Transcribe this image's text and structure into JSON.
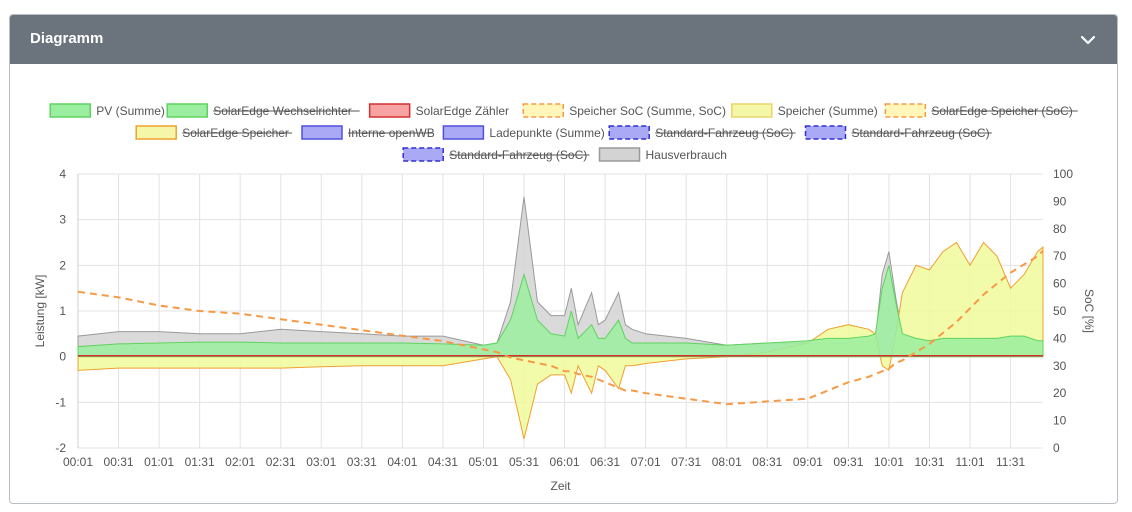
{
  "card": {
    "title": "Diagramm",
    "collapse_icon": "chevron-down-icon"
  },
  "colors": {
    "header_bg": "#6b747d",
    "pv": "#5fd35f",
    "pv_fill": "#9beea0",
    "house": "#9a9a9a",
    "house_fill": "#d3d3d3",
    "storage": "#f0a030",
    "storage_fill": "#eefa9a",
    "soc": "#f79a46",
    "meter": "#d43030"
  },
  "chart_data": {
    "type": "area",
    "xlabel": "Zeit",
    "ylabel": "Leistung [kW]",
    "y2label": "SoC [%]",
    "ylim": [
      -2,
      4
    ],
    "y2lim": [
      0,
      100
    ],
    "yticks": [
      "4",
      "3",
      "2",
      "1",
      "0",
      "-1",
      "-2"
    ],
    "y2ticks": [
      "100",
      "90",
      "80",
      "70",
      "60",
      "50",
      "40",
      "30",
      "20",
      "10",
      "0"
    ],
    "x_ticks": [
      "00:01",
      "00:31",
      "01:01",
      "01:31",
      "02:01",
      "02:31",
      "03:01",
      "03:31",
      "04:01",
      "04:31",
      "05:01",
      "05:31",
      "06:01",
      "06:31",
      "07:01",
      "07:31",
      "08:01",
      "08:31",
      "09:01",
      "09:31",
      "10:01",
      "10:31",
      "11:01",
      "11:31"
    ],
    "grid": true,
    "legend_position": "top",
    "legend": [
      {
        "label": "PV (Summe)",
        "style": "solid",
        "color": "#5fd35f",
        "fill": "#9beea0",
        "hidden": false
      },
      {
        "label": "SolarEdge Wechselrichter",
        "style": "solid",
        "color": "#5fd35f",
        "fill": "#9beea0",
        "hidden": true
      },
      {
        "label": "SolarEdge Zähler",
        "style": "solid",
        "color": "#d43030",
        "fill": "#f7a3a3",
        "hidden": false
      },
      {
        "label": "Speicher SoC (Summe, SoC)",
        "style": "dashed",
        "color": "#f79a46",
        "fill": "#fff6b8",
        "hidden": false
      },
      {
        "label": "Speicher (Summe)",
        "style": "solid",
        "color": "#e8d56a",
        "fill": "#f5f7a8",
        "hidden": false
      },
      {
        "label": "SolarEdge Speicher (SoC)",
        "style": "dashed",
        "color": "#f79a46",
        "fill": "#fff6b8",
        "hidden": true
      },
      {
        "label": "SolarEdge Speicher",
        "style": "solid",
        "color": "#f0a030",
        "fill": "#f5f7a8",
        "hidden": true
      },
      {
        "label": "Interne openWB",
        "style": "solid",
        "color": "#5050e0",
        "fill": "#a9a9f5",
        "hidden": true
      },
      {
        "label": "Ladepunkte (Summe)",
        "style": "solid",
        "color": "#5050e0",
        "fill": "#a9a9f5",
        "hidden": false
      },
      {
        "label": "Standard-Fahrzeug (SoC)",
        "style": "dashed",
        "color": "#3030d0",
        "fill": "#a9a9f5",
        "hidden": true
      },
      {
        "label": "Standard-Fahrzeug (SoC)",
        "style": "dashed",
        "color": "#3030d0",
        "fill": "#a9a9f5",
        "hidden": true
      },
      {
        "label": "Standard-Fahrzeug (SoC)",
        "style": "dashed",
        "color": "#3030d0",
        "fill": "#a9a9f5",
        "hidden": true
      },
      {
        "label": "Hausverbrauch",
        "style": "solid",
        "color": "#9a9a9a",
        "fill": "#d3d3d3",
        "hidden": false
      }
    ],
    "x": [
      "00:01",
      "00:31",
      "01:01",
      "01:31",
      "02:01",
      "02:31",
      "03:01",
      "03:31",
      "04:01",
      "04:31",
      "05:01",
      "05:11",
      "05:21",
      "05:31",
      "05:41",
      "05:51",
      "06:01",
      "06:06",
      "06:11",
      "06:21",
      "06:26",
      "06:31",
      "06:41",
      "06:46",
      "06:51",
      "07:01",
      "07:31",
      "08:01",
      "08:31",
      "09:01",
      "09:16",
      "09:31",
      "09:46",
      "09:51",
      "09:56",
      "10:01",
      "10:06",
      "10:11",
      "10:21",
      "10:31",
      "10:41",
      "10:51",
      "11:01",
      "11:11",
      "11:21",
      "11:31",
      "11:41",
      "11:51",
      "11:55"
    ],
    "series": [
      {
        "name": "PV (Summe)",
        "values": [
          0.22,
          0.28,
          0.3,
          0.32,
          0.32,
          0.3,
          0.3,
          0.3,
          0.3,
          0.28,
          0.25,
          0.3,
          0.8,
          1.8,
          0.8,
          0.5,
          0.45,
          1.0,
          0.4,
          0.7,
          0.4,
          0.4,
          0.8,
          0.4,
          0.3,
          0.3,
          0.3,
          0.25,
          0.3,
          0.35,
          0.4,
          0.4,
          0.45,
          0.5,
          1.5,
          2.0,
          1.2,
          0.5,
          0.4,
          0.35,
          0.4,
          0.4,
          0.4,
          0.4,
          0.4,
          0.45,
          0.45,
          0.35,
          0.35
        ]
      },
      {
        "name": "Hausverbrauch",
        "values": [
          0.45,
          0.55,
          0.55,
          0.5,
          0.5,
          0.6,
          0.55,
          0.5,
          0.45,
          0.45,
          0.25,
          0.3,
          1.2,
          3.5,
          1.2,
          0.9,
          0.9,
          1.5,
          0.7,
          1.4,
          0.7,
          0.8,
          1.4,
          0.7,
          0.6,
          0.5,
          0.4,
          0.25,
          0.3,
          0.3,
          0.3,
          0.3,
          0.35,
          0.4,
          1.8,
          2.3,
          1.3,
          0.5,
          0.4,
          0.35,
          0.4,
          0.4,
          0.35,
          0.4,
          0.4,
          0.45,
          0.45,
          0.35,
          0.35
        ]
      },
      {
        "name": "Speicher (Summe)",
        "values": [
          -0.3,
          -0.25,
          -0.25,
          -0.25,
          -0.25,
          -0.25,
          -0.22,
          -0.2,
          -0.2,
          -0.2,
          -0.05,
          0.0,
          -0.5,
          -1.8,
          -0.6,
          -0.4,
          -0.4,
          -0.8,
          -0.2,
          -0.8,
          -0.2,
          -0.3,
          -0.7,
          -0.2,
          -0.2,
          -0.15,
          -0.05,
          0.0,
          0.1,
          0.3,
          0.6,
          0.7,
          0.6,
          0.5,
          -0.2,
          -0.3,
          0.5,
          1.4,
          2.0,
          1.9,
          2.3,
          2.5,
          2.0,
          2.5,
          2.2,
          1.5,
          1.8,
          2.3,
          2.4
        ]
      },
      {
        "name": "Speicher SoC (Summe, SoC)",
        "axis": "y2",
        "values": [
          57,
          55,
          52,
          50,
          49,
          47,
          45,
          43,
          41,
          39,
          36,
          35,
          33,
          32,
          31,
          30,
          28,
          28,
          27,
          26,
          25,
          24,
          22,
          21,
          21,
          20,
          18,
          16,
          17,
          18,
          21,
          24,
          26,
          27,
          28,
          29,
          31,
          32,
          35,
          38,
          42,
          46,
          51,
          56,
          60,
          64,
          67,
          70,
          72
        ]
      },
      {
        "name": "SolarEdge Zähler",
        "values": [
          0.02,
          0.02,
          0.02,
          0.02,
          0.02,
          0.02,
          0.02,
          0.02,
          0.02,
          0.02,
          0.02,
          0.02,
          0.02,
          0.02,
          0.02,
          0.02,
          0.02,
          0.02,
          0.02,
          0.02,
          0.02,
          0.02,
          0.02,
          0.02,
          0.02,
          0.02,
          0.02,
          0.02,
          0.02,
          0.02,
          0.02,
          0.02,
          0.02,
          0.02,
          0.02,
          0.02,
          0.02,
          0.02,
          0.02,
          0.02,
          0.02,
          0.02,
          0.02,
          0.02,
          0.02,
          0.02,
          0.02,
          0.02,
          0.02
        ]
      }
    ]
  }
}
